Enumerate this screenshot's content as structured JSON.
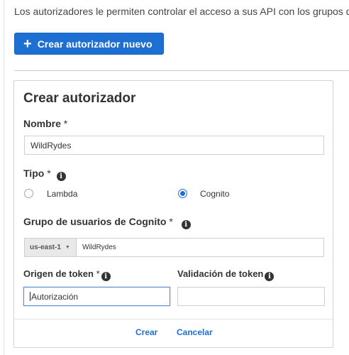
{
  "intro_text": "Los autorizadores le permiten controlar el acceso a sus API con los grupos de",
  "create_new_button": {
    "icon": "plus-icon",
    "label": "Crear autorizador nuevo"
  },
  "form": {
    "title": "Crear autorizador",
    "name": {
      "label": "Nombre",
      "required_mark": "*",
      "value": "WildRydes"
    },
    "type": {
      "label": "Tipo",
      "required_mark": "*",
      "options": [
        {
          "label": "Lambda",
          "selected": false
        },
        {
          "label": "Cognito",
          "selected": true
        }
      ]
    },
    "user_pool": {
      "label": "Grupo de usuarios de Cognito",
      "required_mark": "*",
      "region": "us-east-1",
      "value": "WildRydes"
    },
    "token_source": {
      "label": "Origen de token",
      "required_mark": "*",
      "value": "Autorización"
    },
    "token_validation": {
      "label": "Validación de token",
      "value": ""
    },
    "actions": {
      "create_label": "Crear",
      "cancel_label": "Cancelar"
    }
  },
  "colors": {
    "primary": "#1e6fd2",
    "border": "#cfcfcf",
    "text": "#333333"
  }
}
